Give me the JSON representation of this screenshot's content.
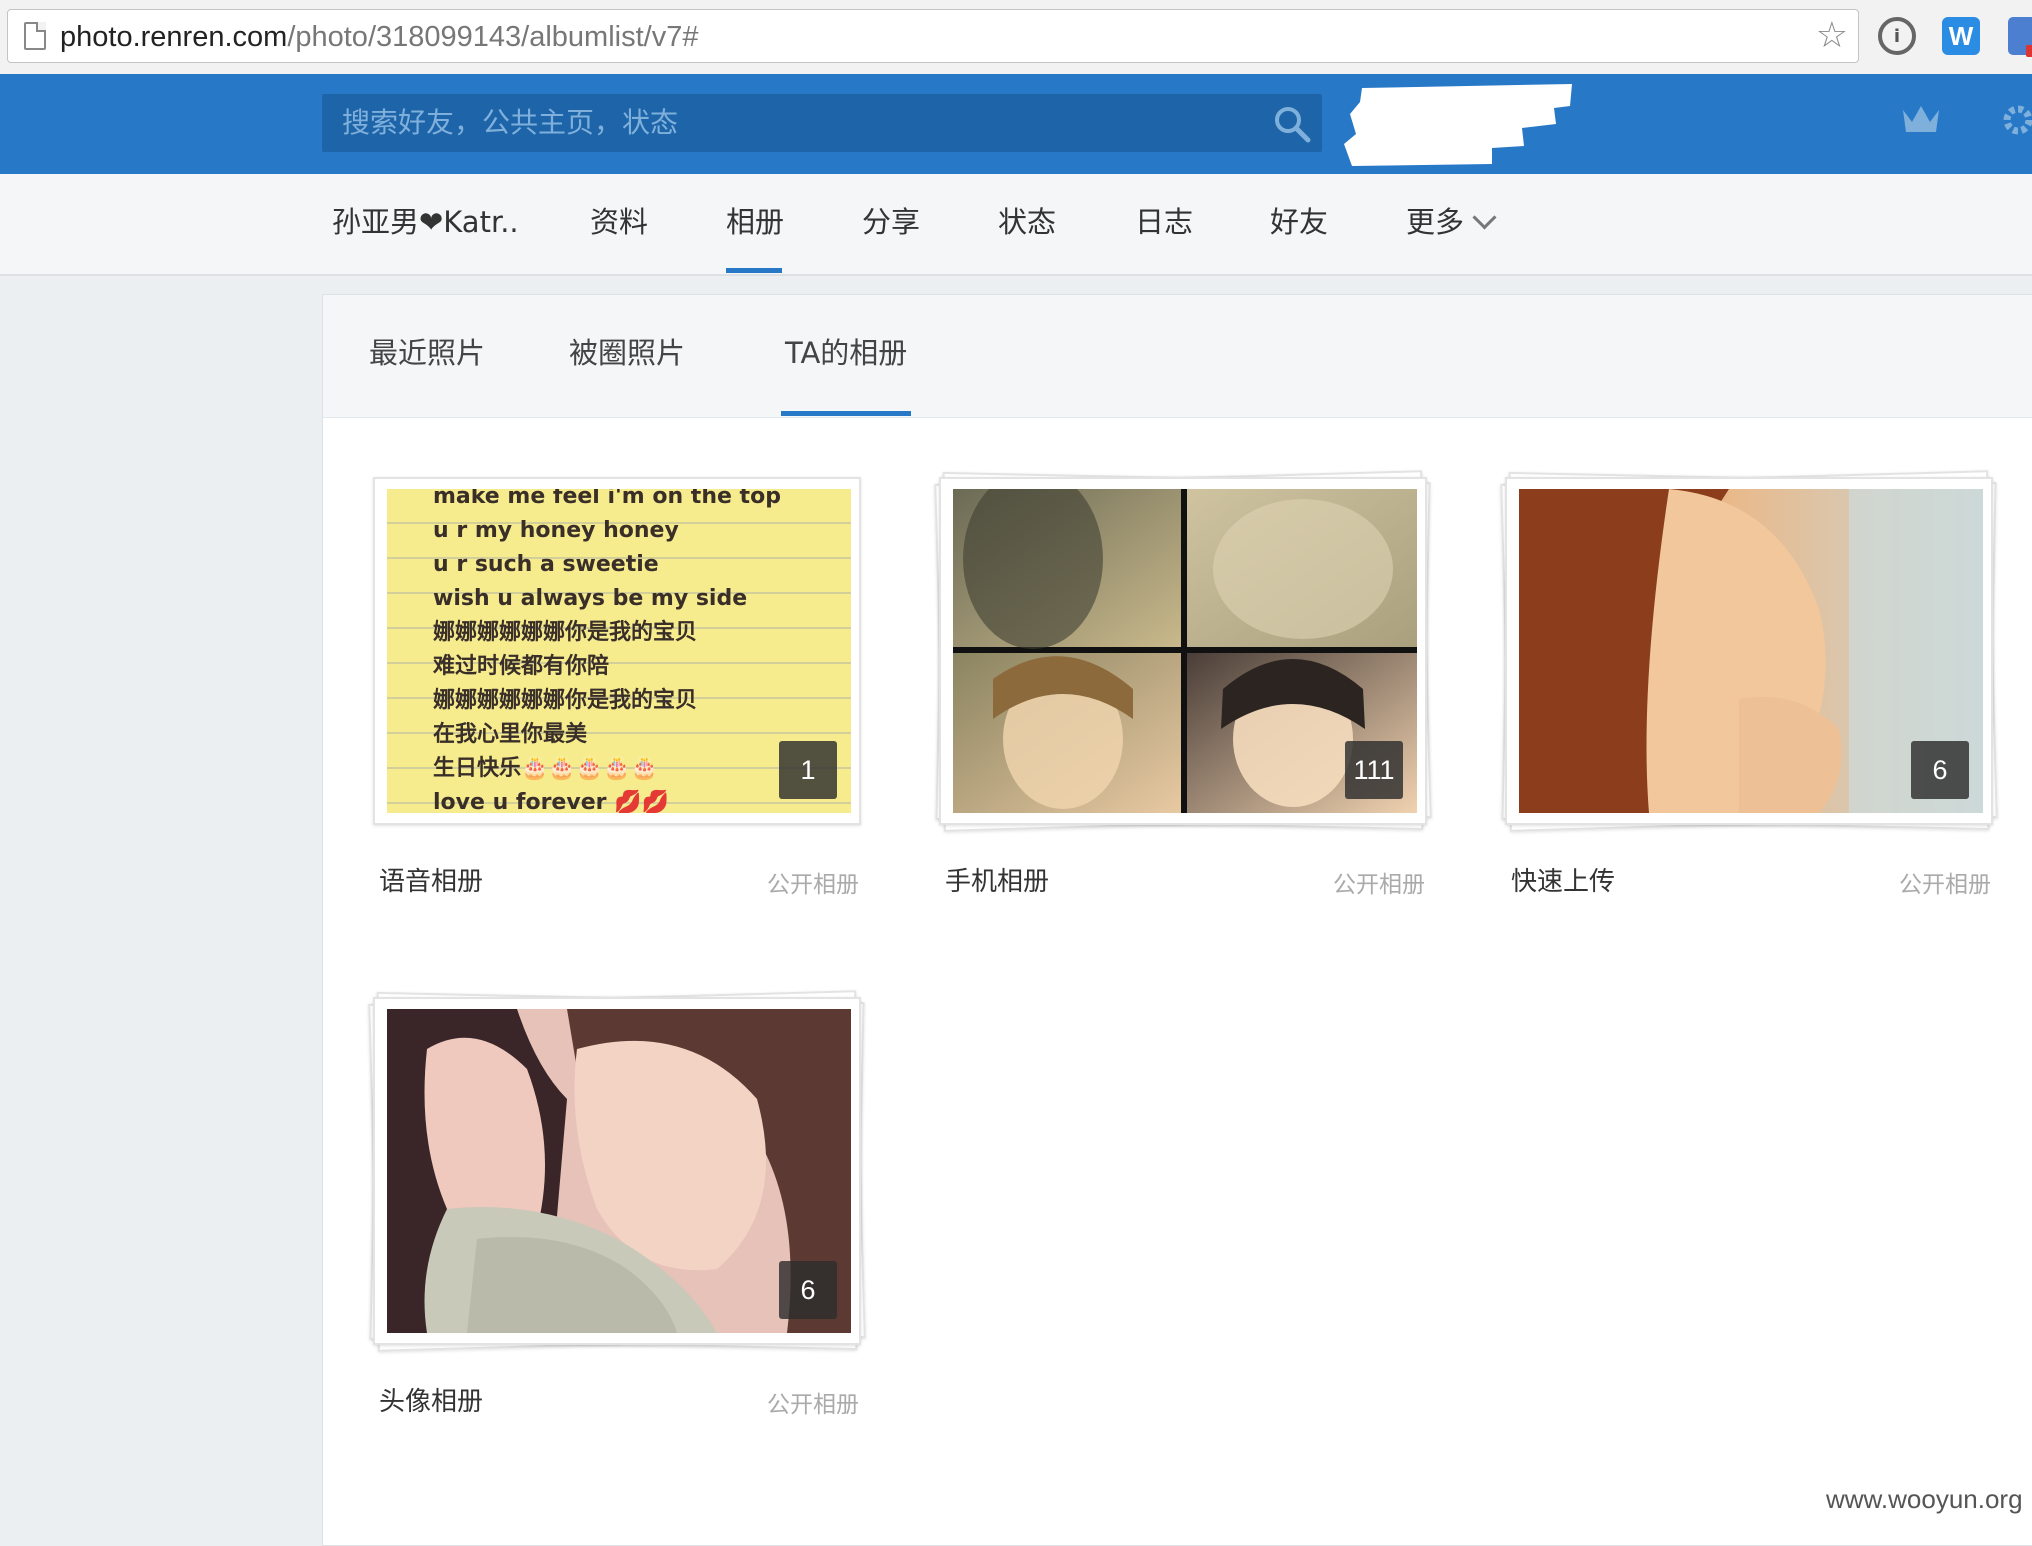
{
  "browser": {
    "url_host": "photo.renren.com",
    "url_path": "/photo/318099143/albumlist/v7#"
  },
  "header": {
    "search_placeholder": "搜索好友，公共主页，状态"
  },
  "profile_nav": {
    "items": [
      {
        "label": "孙亚男❤Katr.."
      },
      {
        "label": "资料"
      },
      {
        "label": "相册"
      },
      {
        "label": "分享"
      },
      {
        "label": "状态"
      },
      {
        "label": "日志"
      },
      {
        "label": "好友"
      },
      {
        "label": "更多"
      }
    ],
    "active": "相册"
  },
  "photo_tabs": {
    "items": [
      {
        "label": "最近照片"
      },
      {
        "label": "被圈照片"
      },
      {
        "label": "TA的相册"
      }
    ],
    "active": "TA的相册"
  },
  "albums": [
    {
      "name": "语音相册",
      "privacy": "公开相册",
      "count": "1",
      "cover_text": [
        "make me feel i'm on the top",
        "u r my honey honey",
        "u r such a sweetie",
        "wish u always be my side",
        "娜娜娜娜娜娜你是我的宝贝",
        "难过时候都有你陪",
        "娜娜娜娜娜娜你是我的宝贝",
        "在我心里你最美",
        "生日快乐🎂🎂🎂🎂🎂",
        "love u forever 💋💋"
      ]
    },
    {
      "name": "手机相册",
      "privacy": "公开相册",
      "count": "111"
    },
    {
      "name": "快速上传",
      "privacy": "公开相册",
      "count": "6"
    },
    {
      "name": "头像相册",
      "privacy": "公开相册",
      "count": "6"
    }
  ],
  "watermark": "www.wooyun.org",
  "colors": {
    "brand_blue": "#2878c8",
    "search_bg": "#1e64a8"
  }
}
